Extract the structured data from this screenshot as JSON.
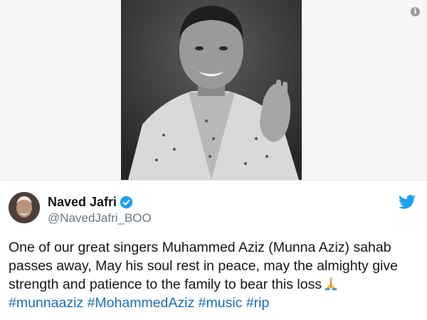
{
  "tweet": {
    "display_name": "Naved Jafri",
    "handle": "@NavedJafri_BOO",
    "text_lines": [
      "One of our great singers Muhammed Aziz (Munna Aziz) sahab",
      "passes away, May his soul rest in peace, may the almighty give",
      "strength and patience to the family to bear this loss"
    ],
    "emoji": "folded-hands",
    "hashtags": [
      "#munnaaziz",
      "#MohammedAziz",
      "#music",
      "#rip"
    ]
  },
  "icons": {
    "info": "info-icon",
    "verified": "verified-badge-icon",
    "brand": "twitter-bird-icon"
  },
  "colors": {
    "hashtag": "#1b6fb3",
    "verified": "#1da1f2",
    "twitter_bird": "#1da1f2",
    "handle": "#657786"
  }
}
